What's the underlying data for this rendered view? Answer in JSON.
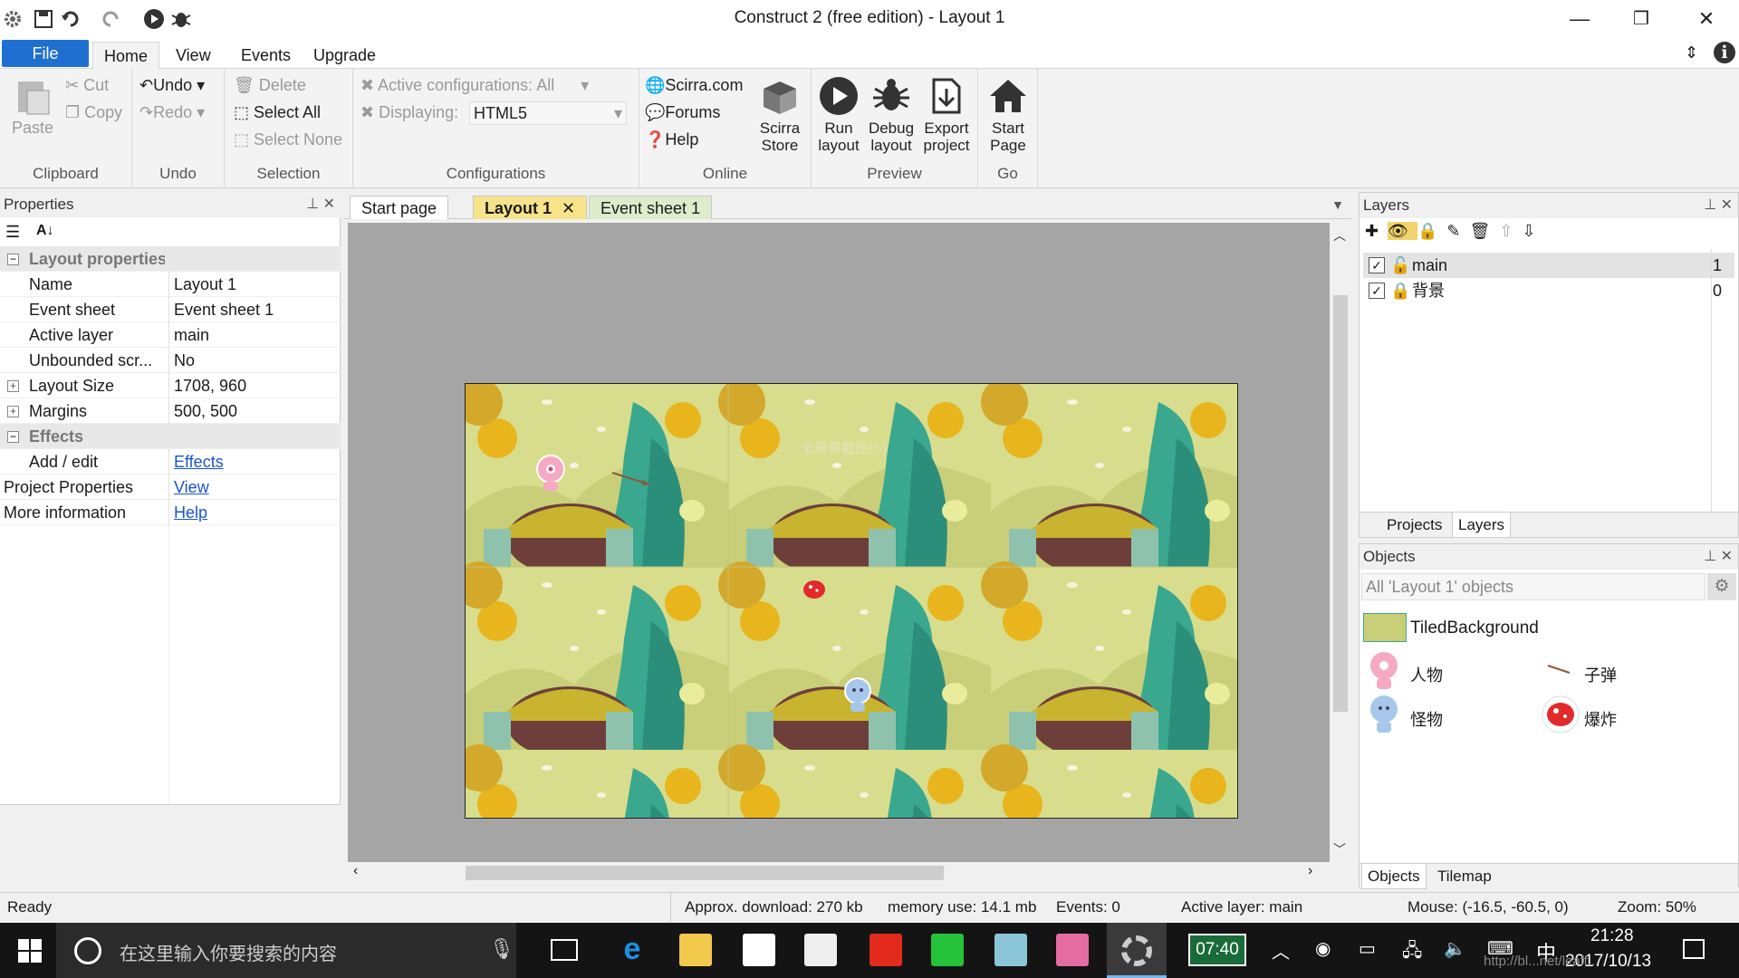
{
  "window": {
    "title": "Construct 2  (free edition) - Layout 1",
    "minimize": "—",
    "restore": "❐",
    "close": "✕"
  },
  "menu": {
    "file": "File",
    "home": "Home",
    "view": "View",
    "events": "Events",
    "upgrade": "Upgrade"
  },
  "ribbon": {
    "clipboard": {
      "paste": "Paste",
      "cut": "Cut",
      "copy": "Copy",
      "label": "Clipboard"
    },
    "undo": {
      "undo": "Undo",
      "redo": "Redo",
      "label": "Undo"
    },
    "selection": {
      "delete": "Delete",
      "select_all": "Select All",
      "select_none": "Select None",
      "label": "Selection"
    },
    "configurations": {
      "active": "Active configurations: All",
      "displaying_label": "Displaying:",
      "displaying_value": "HTML5",
      "label": "Configurations"
    },
    "online": {
      "scirra": "Scirra.com",
      "forums": "Forums",
      "help": "Help",
      "store_line1": "Scirra",
      "store_line2": "Store",
      "label": "Online"
    },
    "preview": {
      "run1": "Run",
      "run2": "layout",
      "debug1": "Debug",
      "debug2": "layout",
      "export1": "Export",
      "export2": "project",
      "label": "Preview"
    },
    "go": {
      "start1": "Start",
      "start2": "Page",
      "label": "Go"
    }
  },
  "properties": {
    "title": "Properties",
    "rows": [
      {
        "key": "Layout properties",
        "value": ""
      },
      {
        "key": "Name",
        "value": "Layout 1"
      },
      {
        "key": "Event sheet",
        "value": "Event sheet 1"
      },
      {
        "key": "Active layer",
        "value": "main"
      },
      {
        "key": "Unbounded scr...",
        "value": "No"
      },
      {
        "key": "Layout Size",
        "value": "1708, 960"
      },
      {
        "key": "Margins",
        "value": "500, 500"
      },
      {
        "key": "Effects",
        "value": ""
      },
      {
        "key": "Add / edit",
        "value": "Effects"
      },
      {
        "key": "Project Properties",
        "value": "View"
      },
      {
        "key": "More information",
        "value": "Help"
      }
    ]
  },
  "doc_tabs": [
    "Start page",
    "Layout 1",
    "Event sheet 1"
  ],
  "layout_watermark": "全屏幕截图(S)",
  "layers": {
    "title": "Layers",
    "rows": [
      {
        "name": "main",
        "index": "1"
      },
      {
        "name": "背景",
        "index": "0"
      }
    ],
    "tabs": [
      "Projects",
      "Layers"
    ]
  },
  "objects": {
    "title": "Objects",
    "filter": "All 'Layout 1' objects",
    "tiled": "TiledBackground",
    "items": [
      "人物",
      "子弹",
      "怪物",
      "爆炸"
    ],
    "tabs": [
      "Objects",
      "Tilemap"
    ]
  },
  "status": {
    "ready": "Ready",
    "download": "Approx. download: 270 kb",
    "memory": "memory use: 14.1 mb",
    "events": "Events: 0",
    "active_layer": "Active layer: main",
    "mouse": "Mouse: (-16.5, -60.5, 0)",
    "zoom": "Zoom: 50%"
  },
  "taskbar": {
    "search_placeholder": "在这里输入你要搜索的内容",
    "clock_app": "07:40",
    "ime": "中",
    "time": "21:28",
    "date": "2017/10/13",
    "watermark": "http://bl...net/leaff..."
  },
  "colors": {
    "accent": "#1f6fd1",
    "active_tab": "#f7e38a",
    "taskbar": "#141414"
  }
}
